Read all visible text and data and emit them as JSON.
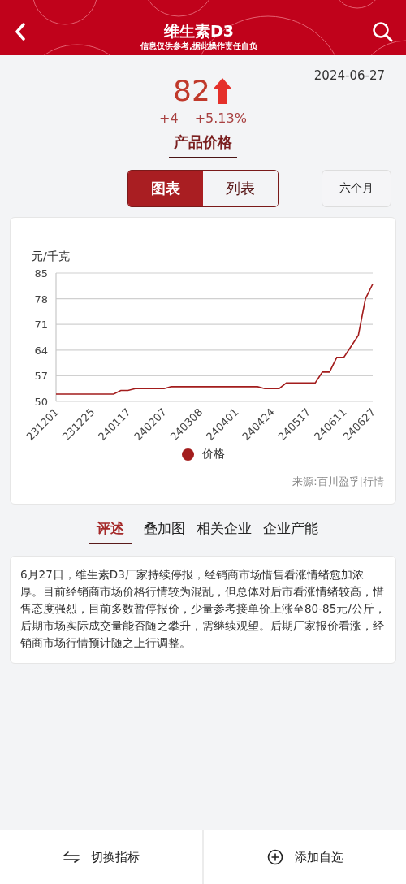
{
  "header": {
    "title": "维生素D3",
    "subtitle": "信息仅供参考,据此操作责任自负"
  },
  "date": "2024-06-27",
  "price": "82",
  "price_up": true,
  "change": "+4",
  "change_pct": "+5.13%",
  "section_title": "产品价格",
  "view_toggle": [
    {
      "label": "图表",
      "selected": true
    },
    {
      "label": "列表",
      "selected": false
    }
  ],
  "period_button": "六个月",
  "chart_panel": {
    "chart_data": {
      "type": "line",
      "ylabel": "元/千克",
      "categories": [
        "231201",
        null,
        null,
        null,
        null,
        "231225",
        null,
        null,
        null,
        null,
        "240117",
        null,
        null,
        null,
        null,
        "240207",
        null,
        null,
        null,
        null,
        "240308",
        null,
        null,
        null,
        null,
        "240401",
        null,
        null,
        null,
        null,
        "240424",
        null,
        null,
        null,
        null,
        "240517",
        null,
        null,
        null,
        null,
        "240611",
        null,
        null,
        null,
        "240627"
      ],
      "series": [
        {
          "name": "价格",
          "color": "#a31d1d",
          "values": [
            52,
            52,
            52,
            52,
            52,
            52,
            52,
            52,
            52,
            53,
            53,
            53.5,
            53.5,
            53.5,
            53.5,
            53.5,
            54,
            54,
            54,
            54,
            54,
            54,
            54,
            54,
            54,
            54,
            54,
            54,
            54,
            53.5,
            53.5,
            53.5,
            55,
            55,
            55,
            55,
            55,
            58,
            58,
            62,
            62,
            65,
            68,
            78,
            82
          ]
        }
      ],
      "ylim": [
        50,
        85
      ],
      "grid": true,
      "yticks": [
        50,
        57,
        64,
        71,
        78,
        85
      ]
    },
    "source": "来源:百川盈孚|行情"
  },
  "tabs": [
    {
      "label": "评述",
      "selected": true
    },
    {
      "label": "叠加图",
      "selected": false
    },
    {
      "label": "相关企业",
      "selected": false
    },
    {
      "label": "企业产能",
      "selected": false
    }
  ],
  "commentary": "6月27日，维生素D3厂家持续停报，经销商市场惜售看涨情绪愈加浓厚。目前经销商市场价格行情较为混乱，但总体对后市看涨情绪较高，惜售态度强烈，目前多数暂停报价，少量参考接单价上涨至80-85元/公斤，后期市场实际成交量能否随之攀升，需继续观望。后期厂家报价看涨，经销商市场行情预计随之上行调整。",
  "bottom_bar": [
    {
      "label": "切换指标",
      "kind": "swap"
    },
    {
      "label": "添加自选",
      "kind": "add"
    }
  ]
}
